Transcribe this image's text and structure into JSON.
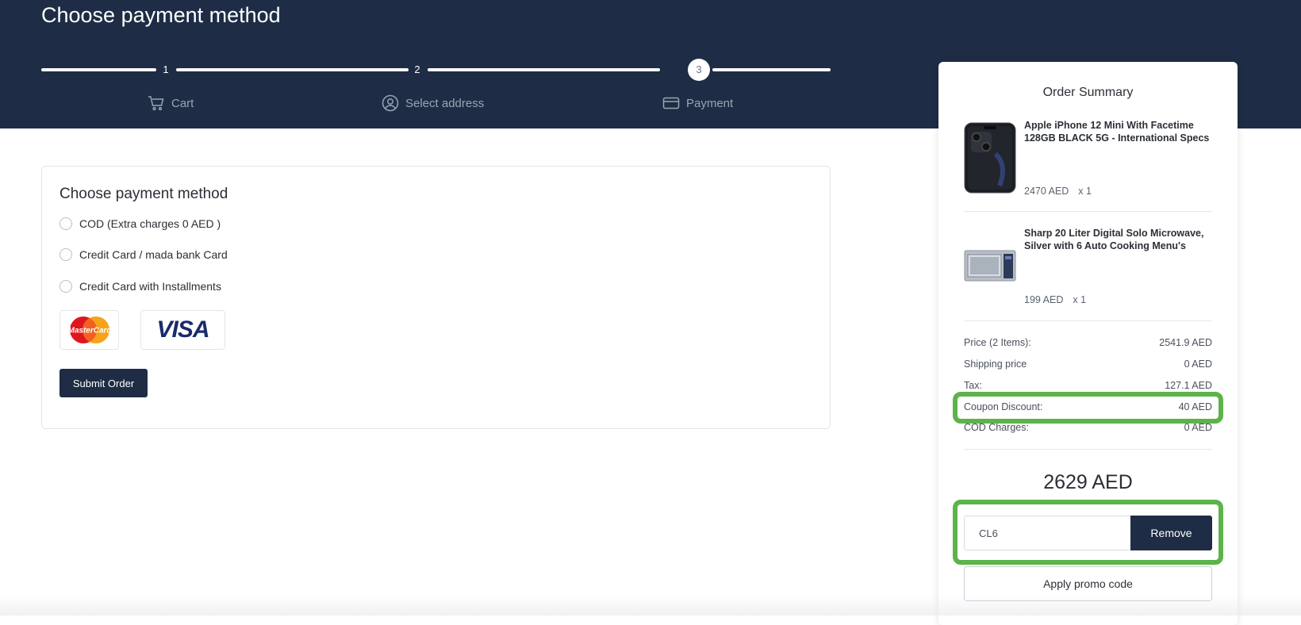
{
  "header": {
    "title": "Choose payment method",
    "steps": [
      {
        "number": "1",
        "label": "Cart",
        "icon": "cart-icon"
      },
      {
        "number": "2",
        "label": "Select address",
        "icon": "user-circle-icon"
      },
      {
        "number": "3",
        "label": "Payment",
        "icon": "credit-card-icon"
      }
    ],
    "active_step": 3
  },
  "payment": {
    "title": "Choose payment method",
    "options": [
      {
        "label": "COD (Extra charges 0 AED )"
      },
      {
        "label": "Credit Card / mada bank Card"
      },
      {
        "label": "Credit Card with Installments"
      }
    ],
    "card_logos": {
      "mastercard": "MasterCard",
      "visa": "VISA"
    },
    "submit_label": "Submit Order"
  },
  "summary": {
    "title": "Order Summary",
    "items": [
      {
        "name": "Apple iPhone 12 Mini With Facetime 128GB BLACK 5G - International Specs",
        "price": "2470 AED",
        "qty": "x 1"
      },
      {
        "name": "Sharp 20 Liter Digital Solo Microwave, Silver with 6 Auto Cooking Menu's",
        "price": "199 AED",
        "qty": "x 1"
      }
    ],
    "rows": [
      {
        "label": "Price (2 Items):",
        "value": "2541.9 AED"
      },
      {
        "label": "Shipping price",
        "value": "0 AED"
      },
      {
        "label": "Tax:",
        "value": "127.1 AED"
      },
      {
        "label": "Coupon Discount:",
        "value": "40 AED"
      },
      {
        "label": "COD Charges:",
        "value": "0 AED"
      }
    ],
    "total": "2629 AED",
    "promo_code": "CL6",
    "remove_label": "Remove",
    "apply_label": "Apply promo code"
  },
  "colors": {
    "header_bg": "#1e2d45",
    "primary_button": "#1e2d45",
    "highlight": "#5cb34a"
  }
}
